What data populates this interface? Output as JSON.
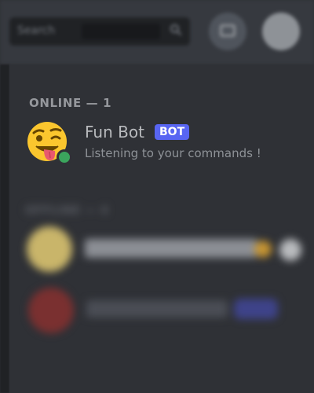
{
  "search": {
    "placeholder": "Search"
  },
  "online_section": {
    "header": "ONLINE — 1"
  },
  "members": [
    {
      "name": "Fun Bot",
      "tag": "BOT",
      "status_text": "Listening to your commands !",
      "avatar_icon": "winking-tongue-emoji-icon",
      "presence": "online",
      "presence_color": "#3ba55d"
    }
  ],
  "offline_section": {
    "header": "OFFLINE — 4"
  },
  "colors": {
    "background": "#2f3136",
    "topbar": "#36393f",
    "bot_tag": "#5865f2"
  }
}
